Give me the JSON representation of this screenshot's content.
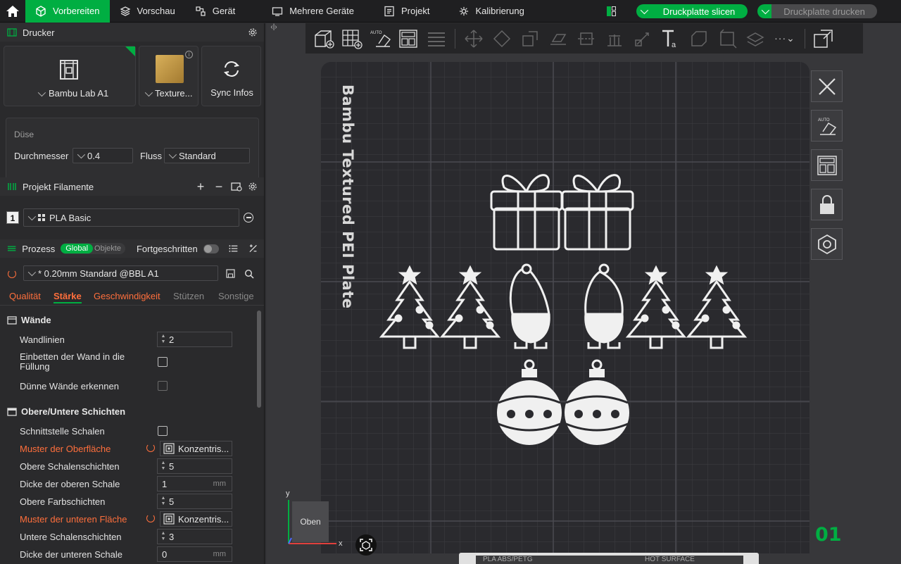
{
  "topbar": {
    "tabs": [
      {
        "label": "Vorbereiten",
        "icon": "cube-icon"
      },
      {
        "label": "Vorschau",
        "icon": "layers-icon"
      },
      {
        "label": "Gerät",
        "icon": "device-icon"
      },
      {
        "label": "Mehrere Geräte",
        "icon": "multi-device-icon"
      },
      {
        "label": "Projekt",
        "icon": "project-icon"
      },
      {
        "label": "Kalibrierung",
        "icon": "calibration-icon"
      }
    ],
    "slice_label": "Druckplatte slicen",
    "print_label": "Druckplatte drucken"
  },
  "printer": {
    "title": "Drucker",
    "model": "Bambu Lab A1",
    "plate": "Texture...",
    "sync": "Sync Infos"
  },
  "nozzle": {
    "title": "Düse",
    "diameter_label": "Durchmesser",
    "diameter_value": "0.4",
    "flow_label": "Fluss",
    "flow_value": "Standard"
  },
  "filament": {
    "title": "Projekt Filamente",
    "items": [
      {
        "index": "1",
        "name": "PLA Basic"
      }
    ]
  },
  "process": {
    "title": "Prozess",
    "toggle_global": "Global",
    "toggle_objects": "Objekte",
    "advanced": "Fortgeschritten",
    "preset": "* 0.20mm Standard @BBL A1",
    "tabs": [
      "Qualität",
      "Stärke",
      "Geschwindigkeit",
      "Stützen",
      "Sonstige"
    ]
  },
  "settings": {
    "walls_title": "Wände",
    "wall_lines_label": "Wandlinien",
    "wall_lines_value": "2",
    "embed_wall_label": "Einbetten der Wand in die Füllung",
    "thin_walls_label": "Dünne Wände erkennen",
    "topbottom_title": "Obere/Untere Schichten",
    "interface_label": "Schnittstelle Schalen",
    "top_pattern_label": "Muster der Oberfläche",
    "top_pattern_value": "Konzentris...",
    "top_shell_layers_label": "Obere Schalenschichten",
    "top_shell_layers_value": "5",
    "top_thickness_label": "Dicke der oberen Schale",
    "top_thickness_value": "1",
    "top_color_layers_label": "Obere Farbschichten",
    "top_color_layers_value": "5",
    "bottom_pattern_label": "Muster der unteren Fläche",
    "bottom_pattern_value": "Konzentris...",
    "bottom_shell_layers_label": "Untere Schalenschichten",
    "bottom_shell_layers_value": "3",
    "bottom_thickness_label": "Dicke der unteren Schale",
    "bottom_thickness_value": "0",
    "unit_mm": "mm"
  },
  "viewport": {
    "plate_label": "Bambu Textured PEI Plate",
    "plate_number": "01",
    "view_cube_label": "Oben",
    "axis_x": "x",
    "axis_y": "y",
    "bottom_text": "PLA ABS/PETG",
    "bottom_hot": "HOT SURFACE"
  },
  "colors": {
    "accent": "#00ae42",
    "modified": "#ff6f3c",
    "panel": "#2a2a2c",
    "plate": "#2a2a2e"
  }
}
